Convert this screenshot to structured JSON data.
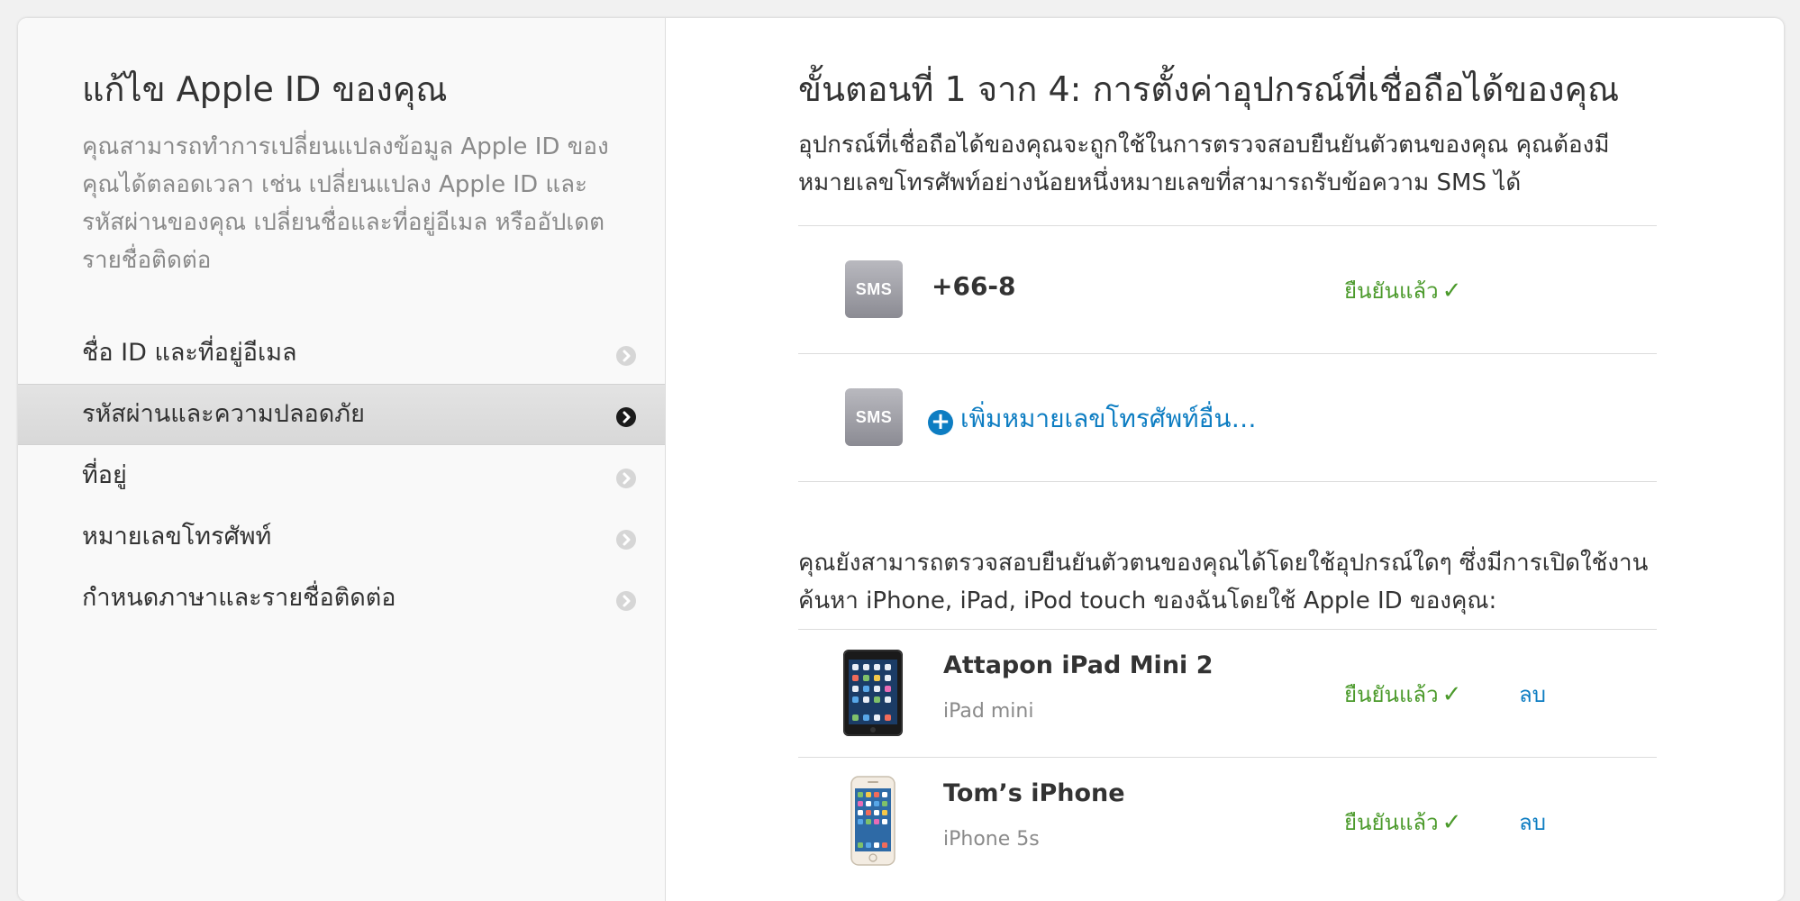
{
  "sidebar": {
    "title": "แก้ไข Apple ID ของคุณ",
    "description": "คุณสามารถทำการเปลี่ยนแปลงข้อมูล Apple ID ของคุณได้ตลอดเวลา เช่น เปลี่ยนแปลง Apple ID และรหัสผ่านของคุณ เปลี่ยนชื่อและที่อยู่อีเมล หรืออัปเดตรายชื่อติดต่อ",
    "items": [
      {
        "label": "ชื่อ ID และที่อยู่อีเมล",
        "active": false
      },
      {
        "label": "รหัสผ่านและความปลอดภัย",
        "active": true
      },
      {
        "label": "ที่อยู่",
        "active": false
      },
      {
        "label": "หมายเลขโทรศัพท์",
        "active": false
      },
      {
        "label": "กำหนดภาษาและรายชื่อติดต่อ",
        "active": false
      }
    ]
  },
  "main": {
    "step_title": "ขั้นตอนที่ 1 จาก 4: การตั้งค่าอุปกรณ์ที่เชื่อถือได้ของคุณ",
    "intro": "อุปกรณ์ที่เชื่อถือได้ของคุณจะถูกใช้ในการตรวจสอบยืนยันตัวตนของคุณ คุณต้องมีหมายเลขโทรศัพท์อย่างน้อยหนึ่งหมายเลขที่สามารถรับข้อความ SMS ได้",
    "sms_badge": "SMS",
    "phone": {
      "number": "+66-8",
      "status": "ยืนยันแล้ว",
      "check": "✓"
    },
    "add_phone": "เพิ่มหมายเลขโทรศัพท์อื่น…",
    "plus_glyph": "+",
    "findmy_text": "คุณยังสามารถตรวจสอบยืนยันตัวตนของคุณได้โดยใช้อุปกรณ์ใดๆ ซึ่งมีการเปิดใช้งาน ค้นหา iPhone, iPad, iPod touch ของฉันโดยใช้ Apple ID ของคุณ:",
    "devices": [
      {
        "name": "Attapon iPad Mini 2",
        "model": "iPad mini",
        "status": "ยืนยันแล้ว",
        "check": "✓",
        "remove": "ลบ",
        "icon": "ipad-icon"
      },
      {
        "name": "Tom’s iPhone",
        "model": "iPhone 5s",
        "status": "ยืนยันแล้ว",
        "check": "✓",
        "remove": "ลบ",
        "icon": "iphone-icon"
      }
    ]
  },
  "colors": {
    "accent_blue": "#0d7dc2",
    "verified_green": "#4b9a2b",
    "active_nav_bg": "#dcdcdc"
  }
}
